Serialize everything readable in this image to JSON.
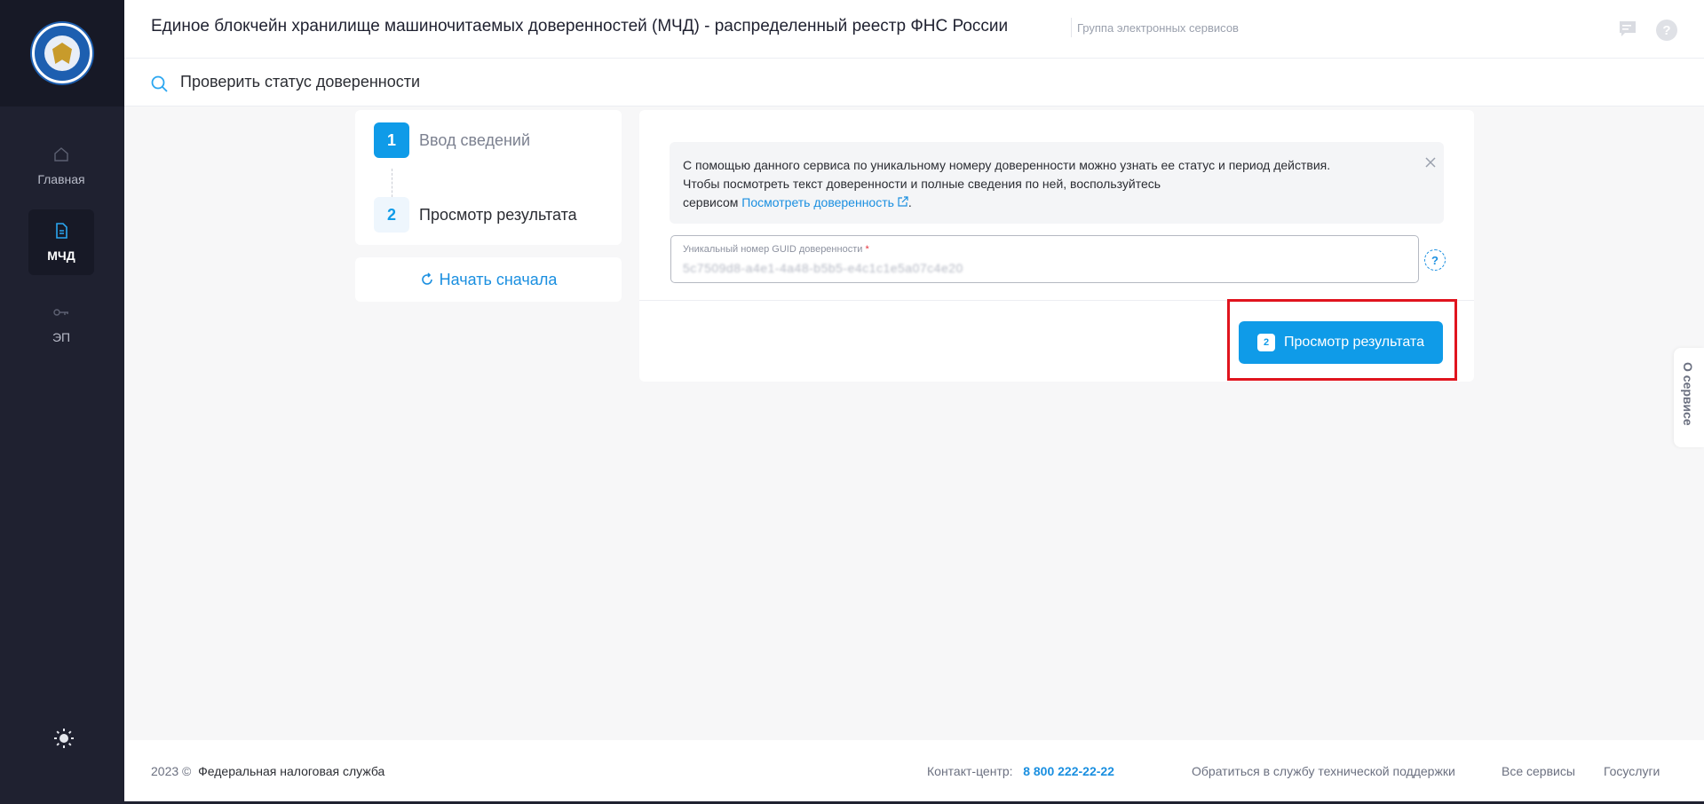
{
  "header": {
    "title": "Единое блокчейн хранилище машиночитаемых доверенностей (МЧД) - распределенный реестр ФНС России",
    "group": "Группа электронных сервисов"
  },
  "sidebar": {
    "items": [
      {
        "label": "Главная",
        "icon": "home-icon"
      },
      {
        "label": "МЧД",
        "icon": "document-icon"
      },
      {
        "label": "ЭП",
        "icon": "key-icon"
      }
    ]
  },
  "subheader": {
    "title": "Проверить статус доверенности"
  },
  "steps": [
    {
      "number": "1",
      "label": "Ввод сведений"
    },
    {
      "number": "2",
      "label": "Просмотр результата"
    }
  ],
  "restart_label": "Начать сначала",
  "info": {
    "line1": "С помощью данного сервиса по уникальному номеру доверенности можно узнать ее статус и период действия.",
    "line2": "Чтобы посмотреть текст доверенности и полные сведения по ней, воспользуйтесь",
    "line3_prefix": "сервисом",
    "link": "Посмотреть доверенность",
    "line3_suffix": "."
  },
  "guid_field": {
    "label": "Уникальный номер GUID доверенности",
    "required_mark": "*",
    "value": "5c7509d8-a4e1-4a48-b5b5-e4c1c1e5a07c4e20"
  },
  "submit": {
    "badge": "2",
    "label": "Просмотр результата"
  },
  "side_tab": "О сервисе",
  "footer": {
    "copyright": "2023 ©",
    "org": "Федеральная налоговая служба",
    "contact_label": "Контакт-центр:",
    "phone": "8 800 222-22-22",
    "support": "Обратиться в службу технической поддержки",
    "all_services": "Все сервисы",
    "gosuslugi": "Госуслуги"
  },
  "colors": {
    "accent": "#0f9be8",
    "sidebar": "#1f2130",
    "highlight": "#e0141e"
  }
}
